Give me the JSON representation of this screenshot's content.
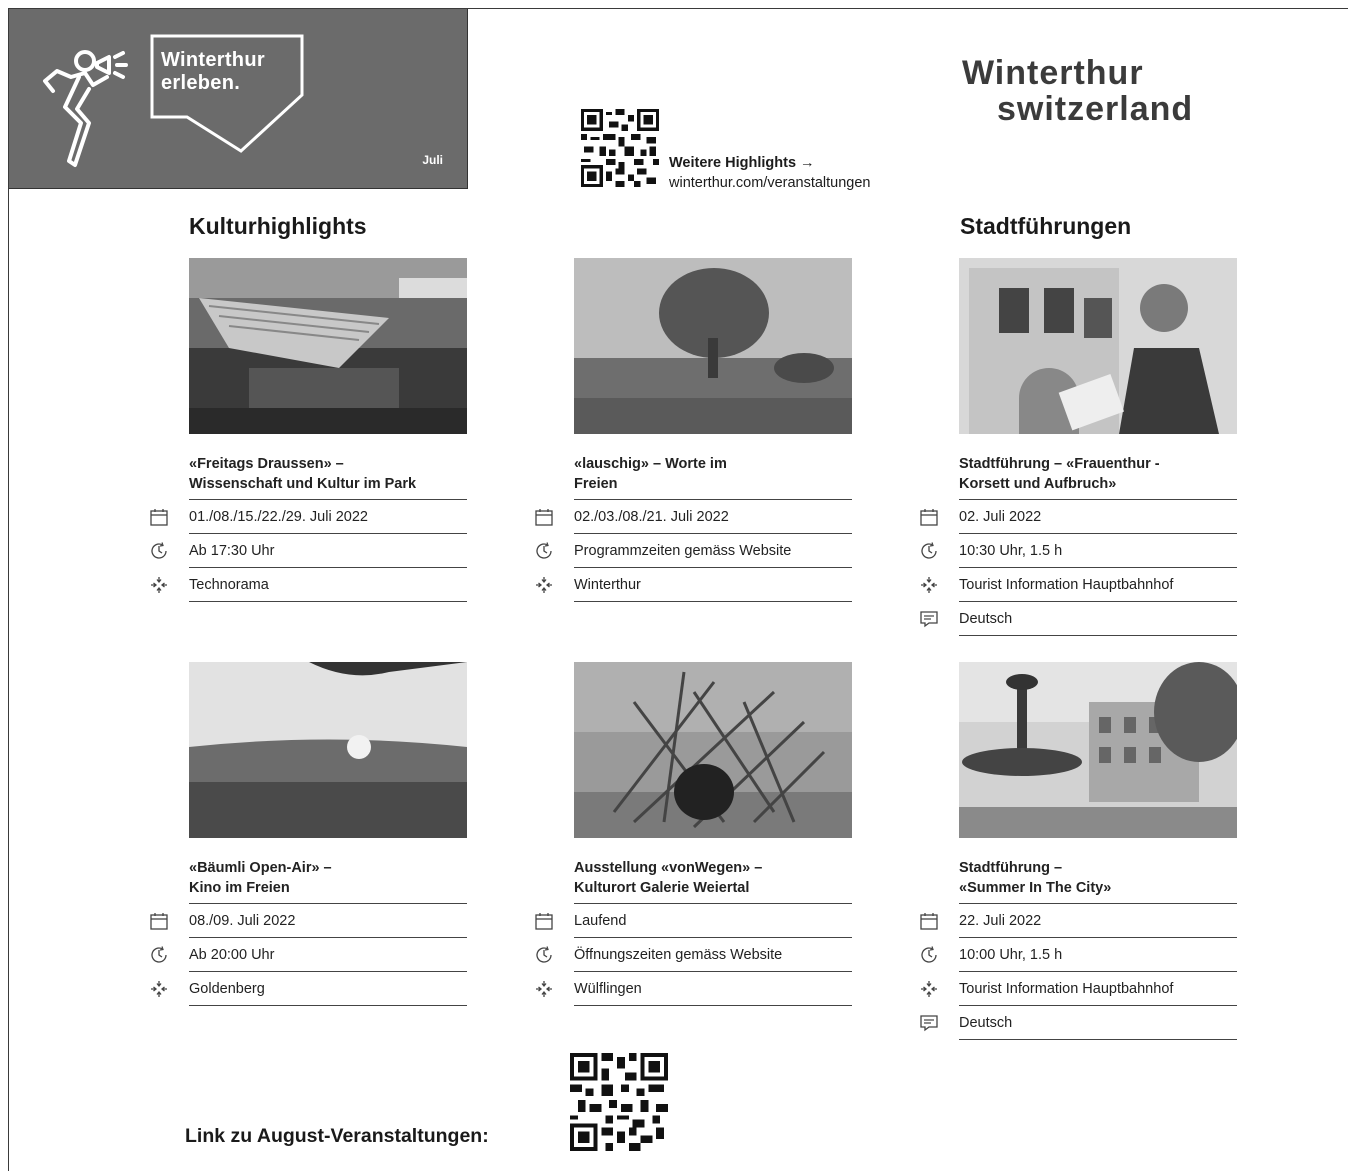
{
  "banner": {
    "title_line1": "Winterthur",
    "title_line2": "erleben.",
    "month": "Juli"
  },
  "top_link": {
    "label": "Weitere Highlights →",
    "url_text": "winterthur.com/veranstaltungen"
  },
  "logo": {
    "line1": "Winterthur",
    "line2": "switzerland"
  },
  "sections": {
    "left": "Kulturhighlights",
    "right": "Stadtführungen"
  },
  "cards": [
    {
      "title1": "«Freitags Draussen» –",
      "title2": "Wissenschaft und Kultur im Park",
      "date": "01./08./15./22./29. Juli 2022",
      "time": "Ab 17:30 Uhr",
      "place": "Technorama",
      "icons": [
        "calendar-icon",
        "clock-icon",
        "location-icon"
      ]
    },
    {
      "title1": "«lauschig» – Worte im",
      "title2": "Freien",
      "date": "02./03./08./21. Juli 2022",
      "time": "Programmzeiten gemäss Website",
      "place": "Winterthur",
      "icons": [
        "calendar-icon",
        "clock-icon",
        "location-icon"
      ]
    },
    {
      "title1": "Stadtführung – «Frauenthur -",
      "title2": "Korsett und Aufbruch»",
      "date": "02. Juli 2022",
      "time": "10:30 Uhr, 1.5 h",
      "place": "Tourist Information Hauptbahnhof",
      "language": "Deutsch",
      "icons": [
        "calendar-icon",
        "clock-icon",
        "location-icon",
        "speech-bubble-icon"
      ]
    },
    {
      "title1": "«Bäumli Open-Air» –",
      "title2": "Kino im Freien",
      "date": "08./09. Juli 2022",
      "time": "Ab 20:00 Uhr",
      "place": "Goldenberg",
      "icons": [
        "calendar-icon",
        "clock-icon",
        "location-icon"
      ]
    },
    {
      "title1": "Ausstellung «vonWegen» –",
      "title2": "Kulturort Galerie Weiertal",
      "date": "Laufend",
      "time": "Öffnungszeiten gemäss Website",
      "place": "Wülflingen",
      "icons": [
        "calendar-icon",
        "clock-icon",
        "location-icon"
      ]
    },
    {
      "title1": "Stadtführung –",
      "title2": "«Summer In The City»",
      "date": "22. Juli 2022",
      "time": "10:00 Uhr, 1.5 h",
      "place": "Tourist Information Hauptbahnhof",
      "language": "Deutsch",
      "icons": [
        "calendar-icon",
        "clock-icon",
        "location-icon",
        "speech-bubble-icon"
      ]
    }
  ],
  "bottom": {
    "link_text": "Link zu August-Veranstaltungen:"
  }
}
